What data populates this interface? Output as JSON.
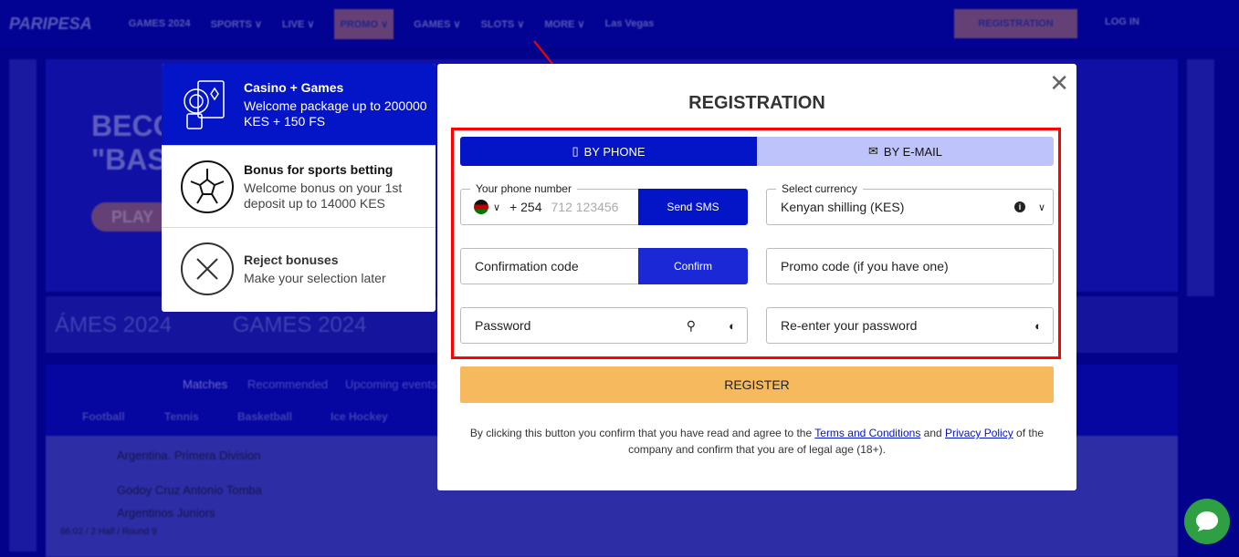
{
  "header": {
    "logo": "PARIPESA",
    "nav": [
      "GAMES 2024",
      "SPORTS ∨",
      "LIVE ∨",
      "PROMO ∨",
      "GAMES ∨",
      "SLOTS ∨",
      "MORE ∨",
      "Las Vegas"
    ],
    "registration": "REGISTRATION",
    "login": "LOG IN"
  },
  "background": {
    "banner_text": "BECO\n\"BAS",
    "play": "PLAY",
    "strip": "ÁMES 2024          GAMES 2024                                                                           ES 2024",
    "tabs": [
      "Matches",
      "Recommended",
      "Upcoming events"
    ],
    "sports": [
      "Football",
      "Tennis",
      "Basketball",
      "Ice Hockey"
    ],
    "league": "Argentina. Primera Division",
    "team1": "Godoy Cruz Antonio Tomba",
    "team2": "Argentinos Juniors",
    "match_info": "86:02 / 2 Half / Round 9"
  },
  "bonuses": [
    {
      "title": "Casino + Games",
      "desc": "Welcome package up to 200000 KES + 150 FS",
      "icon": "casino-chips-cards-icon",
      "selected": true
    },
    {
      "title": "Bonus for sports betting",
      "desc": "Welcome bonus on your 1st deposit up to 14000 KES",
      "icon": "soccer-ball-icon"
    },
    {
      "title": "Reject bonuses",
      "desc": "Make your selection later",
      "icon": "circle-x-icon"
    }
  ],
  "modal": {
    "title": "REGISTRATION",
    "tabs": [
      {
        "label": "BY PHONE",
        "icon": "phone-icon",
        "active": true
      },
      {
        "label": "BY E-MAIL",
        "icon": "envelope-icon"
      }
    ],
    "phone": {
      "label": "Your phone number",
      "code": "+ 254",
      "placeholder": "712 123456",
      "send": "Send SMS"
    },
    "currency": {
      "label": "Select currency",
      "value": "Kenyan shilling (KES)"
    },
    "confirmation": {
      "placeholder": "Confirmation code",
      "button": "Confirm"
    },
    "promo": {
      "placeholder": "Promo code (if you have one)"
    },
    "password": {
      "placeholder": "Password"
    },
    "repassword": {
      "placeholder": "Re-enter your password"
    },
    "register": "REGISTER",
    "terms": {
      "t1": "By clicking this button you confirm that you have read and agree to the ",
      "link1": "Terms and Conditions",
      "t2": " and ",
      "link2": "Privacy Policy",
      "t3": " of the company and confirm that you are of legal age (18+)."
    }
  },
  "colors": {
    "primary": "#0415c7",
    "register": "#f7b95d",
    "highlight": "#ff0000",
    "chat": "#2ea043"
  }
}
